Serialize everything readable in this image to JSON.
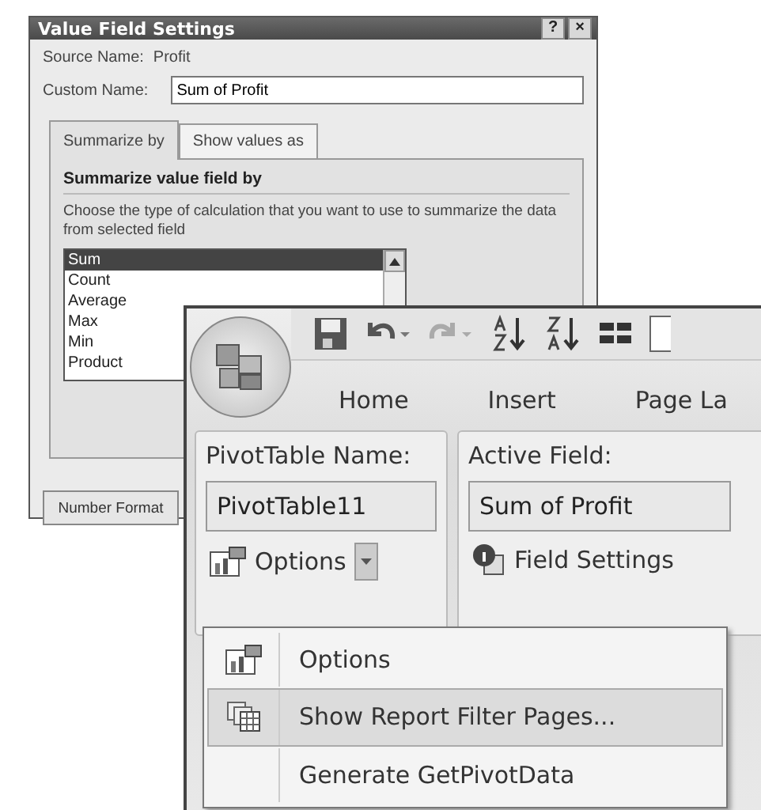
{
  "dialog": {
    "title": "Value Field Settings",
    "help_button": "?",
    "close_button": "×",
    "source_label": "Source Name:",
    "source_value": "Profit",
    "custom_label": "Custom Name:",
    "custom_value": "Sum of Profit",
    "tabs": [
      {
        "label": "Summarize by",
        "selected": true
      },
      {
        "label": "Show values as",
        "selected": false
      }
    ],
    "section_title": "Summarize value field by",
    "description": "Choose the type of calculation that you want to use to summarize the data from selected field",
    "functions": [
      {
        "label": "Sum",
        "selected": true
      },
      {
        "label": "Count",
        "selected": false
      },
      {
        "label": "Average",
        "selected": false
      },
      {
        "label": "Max",
        "selected": false
      },
      {
        "label": "Min",
        "selected": false
      },
      {
        "label": "Product",
        "selected": false
      }
    ],
    "number_format_button": "Number Format"
  },
  "excel": {
    "ribbon_tabs": [
      "Home",
      "Insert",
      "Page La"
    ],
    "pivot_group": {
      "label": "PivotTable Name:",
      "value": "PivotTable11",
      "options_button": "Options"
    },
    "field_group": {
      "label": "Active Field:",
      "value": "Sum of Profit",
      "settings_button": "Field Settings"
    },
    "menu": [
      {
        "label": "Options",
        "kind": "options",
        "selected": false
      },
      {
        "label": "Show Report Filter Pages...",
        "kind": "pages",
        "selected": true
      },
      {
        "label": "Generate GetPivotData",
        "kind": "plain",
        "selected": false
      }
    ]
  }
}
